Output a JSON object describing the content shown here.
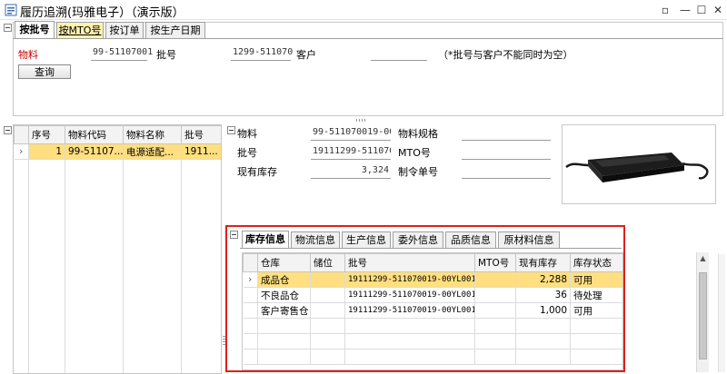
{
  "window": {
    "title": "履历追溯(玛雅电子）（演示版）",
    "min": "—",
    "max": "☐",
    "close": "✕"
  },
  "top_tabs": [
    {
      "label": "按批号"
    },
    {
      "label": "按MTO号"
    },
    {
      "label": "按订单"
    },
    {
      "label": "按生产日期"
    }
  ],
  "query": {
    "material_label": "物料",
    "material_value": "99-51107001",
    "batch_label": "批号",
    "batch_value": "1299-511070",
    "customer_label": "客户",
    "customer_value": "",
    "hint": "（*批号与客户不能同时为空）",
    "query_button": "查询"
  },
  "left_grid": {
    "headers": [
      "序号",
      "物料代码",
      "物料名称",
      "批号"
    ],
    "rows": [
      {
        "seq": "1",
        "code": "99-51107...",
        "name": "电源适配...",
        "batch": "1911..."
      }
    ]
  },
  "detail": {
    "material_label": "物料",
    "material_value": "99-511070019-00\\",
    "spec_label": "物料规格",
    "spec_value": "",
    "batch_label": "批号",
    "batch_value": "19111299-5110700",
    "mto_label": "MTO号",
    "mto_value": "",
    "stock_label": "现有库存",
    "stock_value": "3,324",
    "order_label": "制令单号",
    "order_value": ""
  },
  "info_tabs": [
    {
      "label": "库存信息"
    },
    {
      "label": "物流信息"
    },
    {
      "label": "生产信息"
    },
    {
      "label": "委外信息"
    },
    {
      "label": "品质信息"
    },
    {
      "label": "原材料信息"
    }
  ],
  "stock_grid": {
    "headers": [
      "仓库",
      "储位",
      "批号",
      "MTO号",
      "现有库存",
      "库存状态"
    ],
    "rows": [
      {
        "warehouse": "成品仓",
        "location": "",
        "batch": "19111299-511070019-00YL001",
        "mto": "",
        "qty": "2,288",
        "status": "可用"
      },
      {
        "warehouse": "不良品仓",
        "location": "",
        "batch": "19111299-511070019-00YL001",
        "mto": "",
        "qty": "36",
        "status": "待处理"
      },
      {
        "warehouse": "客户寄售仓",
        "location": "",
        "batch": "19111299-511070019-00YL001",
        "mto": "",
        "qty": "1,000",
        "status": "可用"
      }
    ]
  },
  "colors": {
    "selected_row": "#ffdf7f",
    "highlight_box": "#e0201c",
    "material_label": "#cc0000"
  }
}
